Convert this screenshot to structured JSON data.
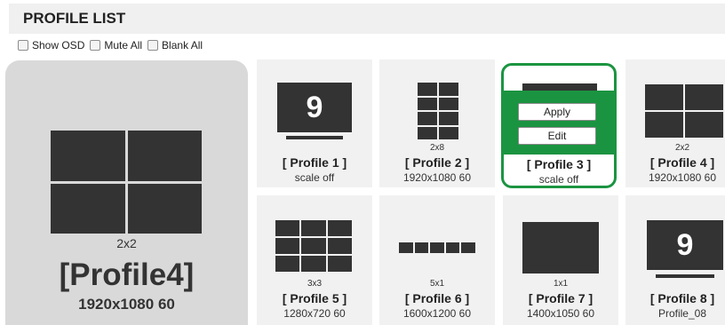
{
  "header": {
    "title": "PROFILE LIST"
  },
  "options": [
    {
      "label": "Show OSD"
    },
    {
      "label": "Mute All"
    },
    {
      "label": "Blank All"
    }
  ],
  "preview": {
    "layout": "2x2",
    "name": "[Profile4]",
    "resolution": "1920x1080 60"
  },
  "profiles": [
    {
      "name": "[ Profile 1 ]",
      "info": "scale off",
      "layout": "",
      "screen_number": "9"
    },
    {
      "name": "[ Profile 2 ]",
      "info": "1920x1080 60",
      "layout": "2x8"
    },
    {
      "name": "[ Profile 3 ]",
      "info": "scale off",
      "layout": "",
      "actions": {
        "apply": "Apply",
        "edit": "Edit"
      }
    },
    {
      "name": "[ Profile 4 ]",
      "info": "1920x1080 60",
      "layout": "2x2"
    },
    {
      "name": "[ Profile 5 ]",
      "info": "1280x720 60",
      "layout": "3x3"
    },
    {
      "name": "[ Profile 6 ]",
      "info": "1600x1200 60",
      "layout": "5x1"
    },
    {
      "name": "[ Profile 7 ]",
      "info": "1400x1050 60",
      "layout": "1x1"
    },
    {
      "name": "[ Profile 8 ]",
      "info": "Profile_08",
      "layout": "",
      "screen_number": "9"
    }
  ],
  "colors": {
    "selected_accent": "#1b9441",
    "screen": "#333333",
    "card_bg": "#f1f1f1",
    "preview_bg": "#d9d9d9"
  }
}
